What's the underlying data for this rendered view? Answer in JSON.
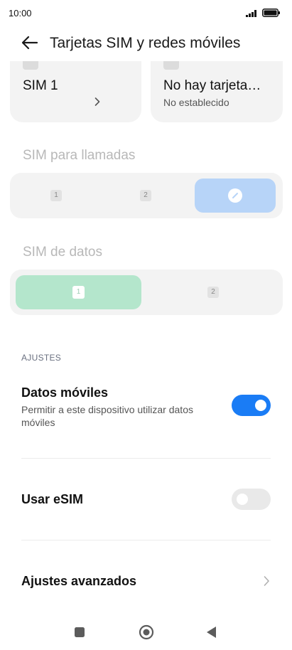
{
  "status_bar": {
    "time": "10:00"
  },
  "header": {
    "title": "Tarjetas SIM y redes móviles"
  },
  "sim_cards": [
    {
      "name": "SIM 1",
      "subtitle": ""
    },
    {
      "name": "No hay tarjeta…",
      "subtitle": "No establecido"
    }
  ],
  "calls": {
    "label": "SIM para llamadas",
    "options": [
      "1",
      "2"
    ]
  },
  "data_sim": {
    "label": "SIM de datos",
    "options": [
      "1",
      "2"
    ],
    "selected": "1"
  },
  "settings": {
    "header": "AJUSTES",
    "mobile_data": {
      "title": "Datos móviles",
      "subtitle": "Permitir a este dispositivo utilizar datos móviles",
      "enabled": true
    },
    "esim": {
      "title": "Usar eSIM",
      "enabled": false
    },
    "advanced": {
      "title": "Ajustes avanzados"
    }
  },
  "colors": {
    "accent": "#1a7cf5",
    "calls_selected": "#b7d4f8",
    "data_selected": "#b4e6cc"
  }
}
